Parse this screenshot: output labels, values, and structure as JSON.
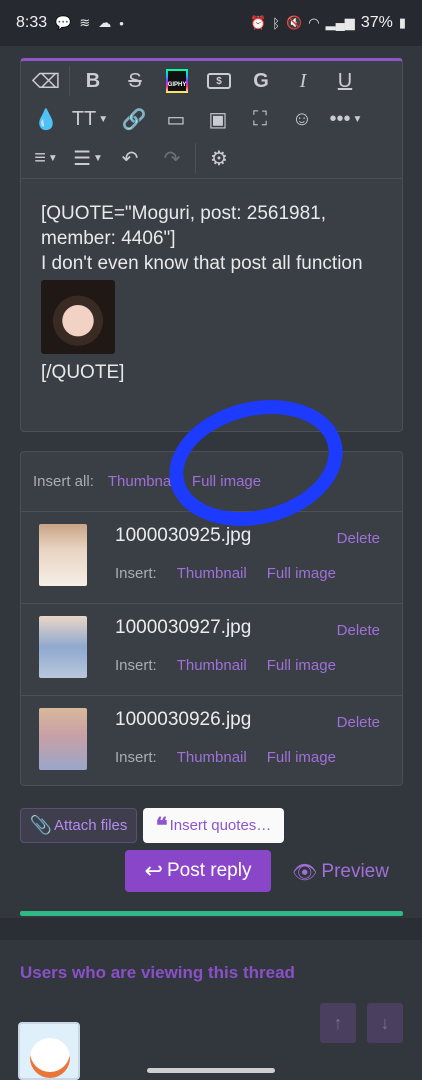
{
  "status_bar": {
    "time": "8:33",
    "battery": "37%"
  },
  "editor": {
    "content_lines": [
      "[QUOTE=\"Moguri, post: 2561981, member: 4406\"]",
      "I don't even know that post all function",
      "[/QUOTE]"
    ],
    "giphy_label": "GIPHY"
  },
  "attachments": {
    "insert_all_label": "Insert all:",
    "thumbnail_label": "Thumbnail",
    "full_image_label": "Full image",
    "insert_label": "Insert:",
    "delete_label": "Delete",
    "files": [
      {
        "name": "1000030925.jpg"
      },
      {
        "name": "1000030927.jpg"
      },
      {
        "name": "1000030926.jpg"
      }
    ]
  },
  "actions": {
    "attach_files": "Attach files",
    "insert_quotes": "Insert quotes…",
    "post_reply": "Post reply",
    "preview": "Preview"
  },
  "viewers": {
    "title": "Users who are viewing this thread"
  },
  "colors": {
    "accent": "#8a46c8",
    "annotation_circle": "#1d3bff",
    "progress": "#2fb985"
  }
}
